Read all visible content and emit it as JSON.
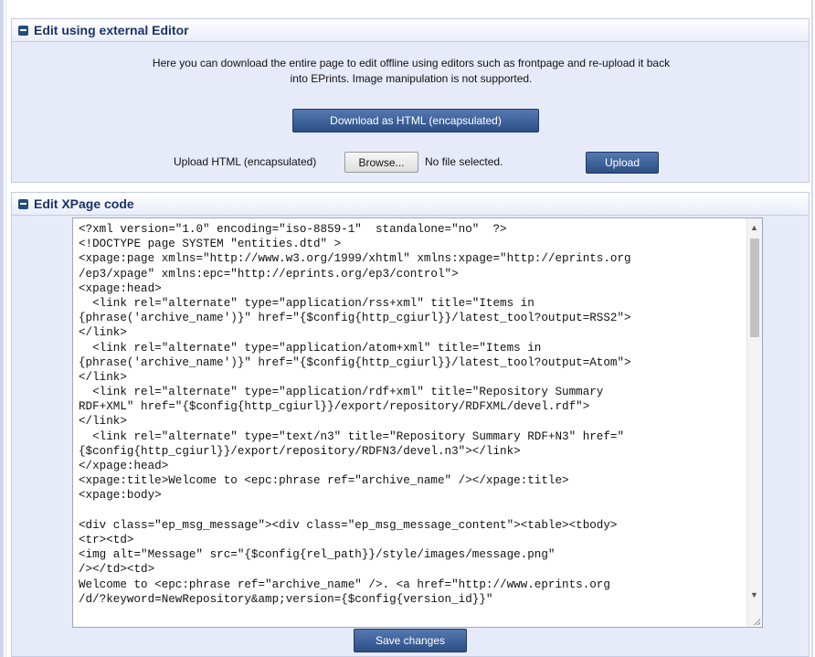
{
  "external_editor": {
    "title": "Edit using external Editor",
    "description_line1": "Here you can download the entire page to edit offline using editors such as frontpage and re-upload it back",
    "description_line2": "into EPrints. Image manipulation is not supported.",
    "download_label": "Download as HTML (encapsulated)",
    "upload_label": "Upload HTML (encapsulated)",
    "browse_label": "Browse...",
    "file_status": "No file selected.",
    "upload_button": "Upload"
  },
  "xpage_editor": {
    "title": "Edit XPage code",
    "save_label": "Save changes",
    "code_lines": [
      "<?xml version=\"1.0\" encoding=\"iso-8859-1\"  standalone=\"no\"  ?>",
      "<!DOCTYPE page SYSTEM \"entities.dtd\" >",
      "<xpage:page xmlns=\"http://www.w3.org/1999/xhtml\" xmlns:xpage=\"http://eprints.org",
      "/ep3/xpage\" xmlns:epc=\"http://eprints.org/ep3/control\">",
      "<xpage:head>",
      "  <link rel=\"alternate\" type=\"application/rss+xml\" title=\"Items in",
      "{phrase('archive_name')}\" href=\"{$config{http_cgiurl}}/latest_tool?output=RSS2\">",
      "</link>",
      "  <link rel=\"alternate\" type=\"application/atom+xml\" title=\"Items in",
      "{phrase('archive_name')}\" href=\"{$config{http_cgiurl}}/latest_tool?output=Atom\">",
      "</link>",
      "  <link rel=\"alternate\" type=\"application/rdf+xml\" title=\"Repository Summary",
      "RDF+XML\" href=\"{$config{http_cgiurl}}/export/repository/RDFXML/devel.rdf\">",
      "</link>",
      "  <link rel=\"alternate\" type=\"text/n3\" title=\"Repository Summary RDF+N3\" href=\"",
      "{$config{http_cgiurl}}/export/repository/RDFN3/devel.n3\"></link>",
      "</xpage:head>",
      "<xpage:title>Welcome to <epc:phrase ref=\"archive_name\" /></xpage:title>",
      "<xpage:body>",
      "",
      "<div class=\"ep_msg_message\"><div class=\"ep_msg_message_content\"><table><tbody>",
      "<tr><td>",
      "<img alt=\"Message\" src=\"{$config{rel_path}}/style/images/message.png\"",
      "/></td><td>",
      "Welcome to <epc:phrase ref=\"archive_name\" />. <a href=\"http://www.eprints.org",
      "/d/?keyword=NewRepository&amp;version={$config{version_id}}\""
    ]
  }
}
